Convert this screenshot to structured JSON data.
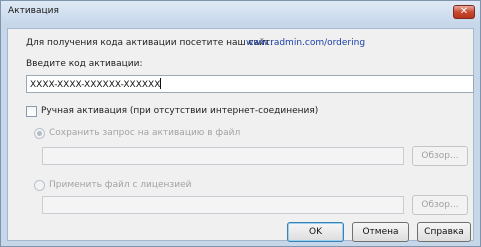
{
  "window": {
    "title": "Активация",
    "close_glyph": "✕"
  },
  "intro": {
    "text": "Для получения кода активации посетите наш сайт:",
    "link": "www.radmin.com/ordering"
  },
  "code": {
    "label": "Введите код активации:",
    "value": "XXXX-XXXX-XXXXXX-XXXXXX"
  },
  "manual": {
    "label": "Ручная активация (при отсутствии интернет-соединения)",
    "checked": false
  },
  "save_request": {
    "label": "Сохранить запрос на активацию в файл",
    "selected": true,
    "enabled": false,
    "path": ""
  },
  "apply_license": {
    "label": "Применить файл с лицензией",
    "selected": false,
    "enabled": false,
    "path": ""
  },
  "buttons": {
    "browse": "Обзор...",
    "ok": "OK",
    "cancel": "Отмена",
    "help": "Справка"
  }
}
